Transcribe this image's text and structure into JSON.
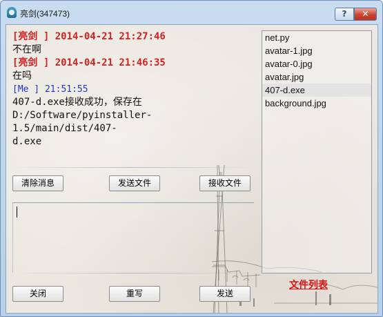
{
  "window": {
    "title": "亮剑(347473)",
    "help_label": "?",
    "close_label": "✕"
  },
  "chat": {
    "messages": [
      {
        "header": "[亮剑 ] 2014-04-21 21:27:46",
        "text": "不在啊"
      },
      {
        "header": "[亮剑 ] 2014-04-21 21:46:35",
        "text": "在吗"
      },
      {
        "header": "[Me ] 21:51:55",
        "text_lines": [
          "407-d.exe接收成功，保存在",
          "D:/Software/pyinstaller-1.5/main/dist/407-",
          "d.exe"
        ]
      }
    ]
  },
  "actions": {
    "clear_label": "清除消息",
    "send_file_label": "发送文件",
    "receive_file_label": "接收文件"
  },
  "input": {
    "value": ""
  },
  "bottom": {
    "close_label": "关闭",
    "rewrite_label": "重写",
    "send_label": "发送"
  },
  "file_list": {
    "label": "文件列表",
    "items": [
      "net.py",
      "avatar-1.jpg",
      "avatar-0.jpg",
      "avatar.jpg",
      "407-d.exe",
      "background.jpg"
    ],
    "selected": "407-d.exe"
  },
  "colors": {
    "other_header": "#d42020",
    "me_header": "#2233cc",
    "file_list_label": "#dd1111"
  }
}
